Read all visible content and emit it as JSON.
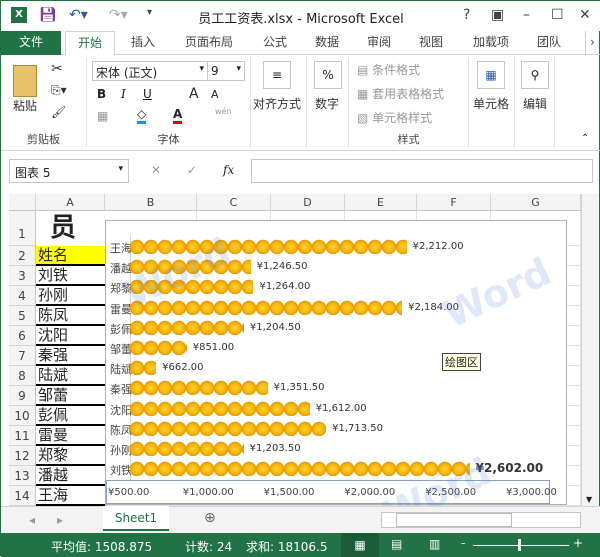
{
  "title": "员工工资表.xlsx - Microsoft Excel",
  "title_buttons": [
    "?",
    "▣",
    "–",
    "☐",
    "✕"
  ],
  "tabs": [
    "文件",
    "开始",
    "插入",
    "页面布局",
    "公式",
    "数据",
    "审阅",
    "视图",
    "加载项",
    "团队"
  ],
  "ribbon": {
    "paste": "粘贴",
    "clipboard": "剪贴板",
    "font_name": "宋体 (正文)",
    "font_size": "9",
    "font_group": "字体",
    "bold": "B",
    "italic": "I",
    "underline": "U",
    "grow": "A",
    "shrink": "A",
    "wen": "wén",
    "align": "对齐方式",
    "number": "数字",
    "percent": "%",
    "cond_format": "条件格式",
    "table_format": "套用表格格式",
    "cell_style": "单元格样式",
    "styles": "样式",
    "cells": "单元格",
    "edit": "编辑"
  },
  "formula_bar": {
    "name_box": "图表 5",
    "fx": "fx",
    "value": ""
  },
  "columns": [
    "A",
    "B",
    "C",
    "D",
    "E",
    "F",
    "G"
  ],
  "rows": [
    "1",
    "2",
    "3",
    "4",
    "5",
    "6",
    "7",
    "8",
    "9",
    "10",
    "11",
    "12",
    "13",
    "14"
  ],
  "column_a": [
    "员",
    "姓名",
    "刘铁",
    "孙刚",
    "陈凤",
    "沈阳",
    "秦强",
    "陆斌",
    "邹蕾",
    "彭佩",
    "雷曼",
    "郑黎",
    "潘越",
    "王海"
  ],
  "header_fill": "#ffff00",
  "chart_data": {
    "type": "bar",
    "orientation": "horizontal",
    "categories": [
      "王海",
      "潘越",
      "郑黎",
      "雷曼",
      "彭佩",
      "邹蕾",
      "陆斌",
      "秦强",
      "沈阳",
      "陈凤",
      "孙刚",
      "刘铁"
    ],
    "values": [
      2212,
      1246.5,
      1264,
      2184,
      1204.5,
      851,
      662,
      1351.5,
      1612,
      1713.5,
      1203.5,
      2602
    ],
    "value_labels": [
      "¥2,212.00",
      "¥1,246.50",
      "¥1,264.00",
      "¥2,184.00",
      "¥1,204.50",
      "¥851.00",
      "¥662.00",
      "¥1,351.50",
      "¥1,612.00",
      "¥1,713.50",
      "¥1,203.50",
      "¥2,602.00"
    ],
    "xlim": [
      500,
      3000
    ],
    "xticks": [
      "¥500.00",
      "¥1,000.00",
      "¥1,500.00",
      "¥2,000.00",
      "¥2,500.00",
      "¥3,000.00"
    ],
    "fill": "gold coin picture",
    "tooltip": "绘图区"
  },
  "sheet_tab": "Sheet1",
  "status": {
    "average": "平均值: 1508.875",
    "count": "计数: 24",
    "sum": "求和: 18106.5"
  },
  "watermark": "Word联盟"
}
